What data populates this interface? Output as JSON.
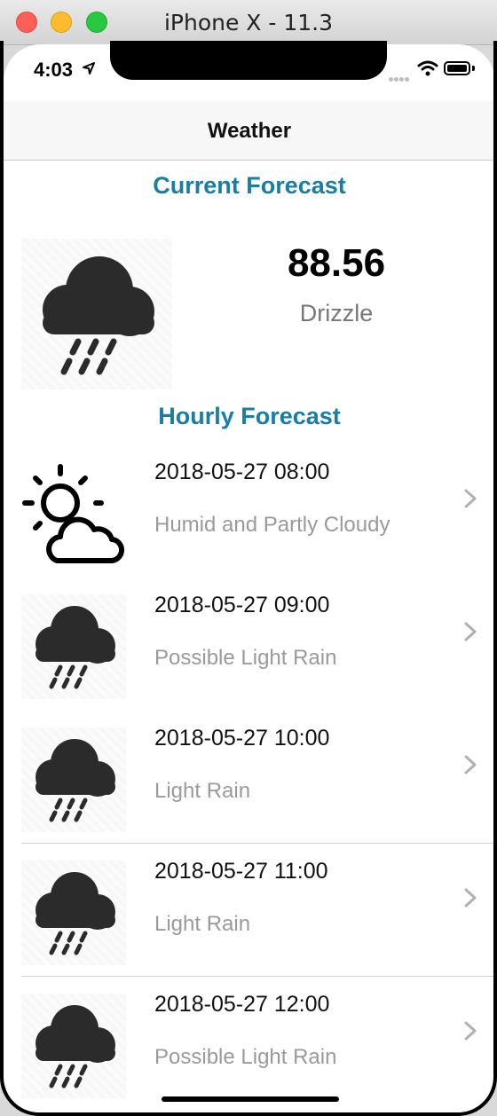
{
  "window": {
    "title": "iPhone X - 11.3"
  },
  "status_bar": {
    "time": "4:03"
  },
  "nav": {
    "title": "Weather"
  },
  "current": {
    "section_title": "Current Forecast",
    "temperature": "88.56",
    "summary": "Drizzle",
    "icon": "rain-cloud-icon"
  },
  "hourly": {
    "section_title": "Hourly Forecast",
    "items": [
      {
        "time": "2018-05-27 08:00",
        "summary": "Humid and Partly Cloudy",
        "icon": "partly-cloudy-day-icon"
      },
      {
        "time": "2018-05-27 09:00",
        "summary": "Possible Light Rain",
        "icon": "rain-cloud-icon"
      },
      {
        "time": "2018-05-27 10:00",
        "summary": "Light Rain",
        "icon": "rain-cloud-icon"
      },
      {
        "time": "2018-05-27 11:00",
        "summary": "Light Rain",
        "icon": "rain-cloud-icon"
      },
      {
        "time": "2018-05-27 12:00",
        "summary": "Possible Light Rain",
        "icon": "rain-cloud-icon"
      }
    ]
  },
  "colors": {
    "accent": "#1a7ea3",
    "secondary_text": "#9a9a9a"
  }
}
